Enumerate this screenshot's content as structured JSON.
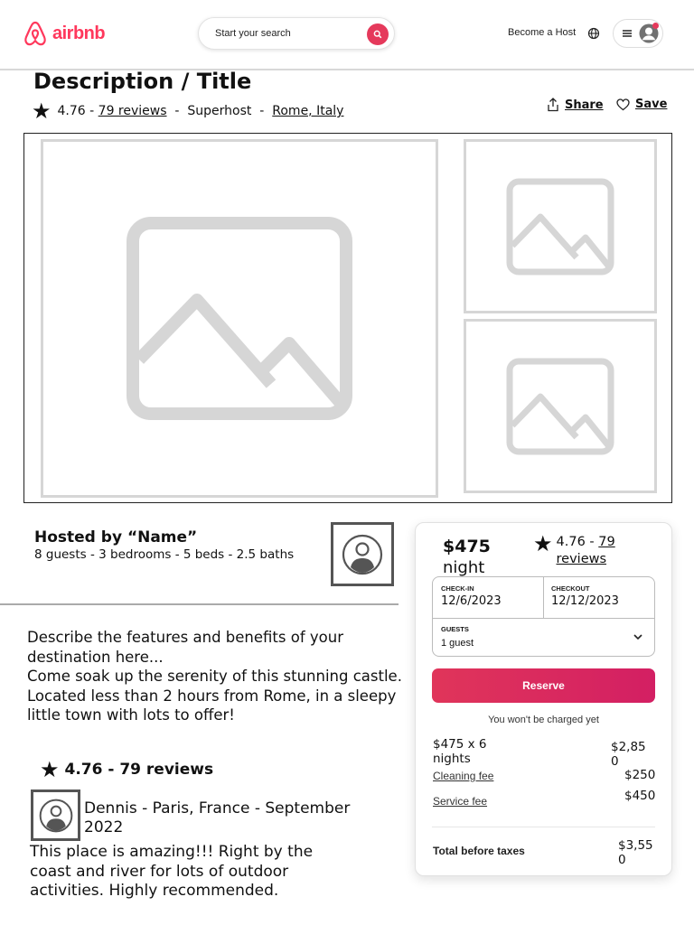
{
  "header": {
    "brand": "airbnb",
    "search_label": "Start your search",
    "host_link": "Become a Host",
    "colors": {
      "brand": "#ff385c",
      "accent": "#e5395b"
    }
  },
  "listing": {
    "title": "Description / Title",
    "rating": "4.76 -",
    "reviews_link": "79 reviews",
    "sep1": "-",
    "superhost": "Superhost",
    "sep2": "-",
    "location": "Rome, Italy",
    "share": "Share",
    "save": "Save"
  },
  "host": {
    "hosted_by": "Hosted by “Name”",
    "specs": "8 guests  -  3 bedrooms  -  5 beds  -  2.5 baths"
  },
  "description": {
    "lines": [
      "Describe the features and benefits of your destination here...",
      "Come soak up the serenity of this stunning castle.  Located less than 2 hours from Rome, in a sleepy little town with lots to offer!"
    ]
  },
  "reviews": {
    "heading": "4.76 - 79 reviews",
    "items": [
      {
        "author": "Dennis - Paris, France - September 2022",
        "text": "This place is amazing!!!  Right by the coast and river for lots of outdoor activities.  Highly recommended."
      }
    ]
  },
  "booking": {
    "price": "$475",
    "per": "night",
    "rating": "4.76 -",
    "reviews_link": "79 reviews",
    "checkin_label": "CHECK-IN",
    "checkin_value": "12/6/2023",
    "checkout_label": "CHECKOUT",
    "checkout_value": "12/12/2023",
    "guests_label": "GUESTS",
    "guests_value": "1 guest",
    "reserve": "Reserve",
    "notice": "You won't be charged yet",
    "nights_label": "$475 x 6 nights",
    "nights_value": "$2,850",
    "cleaning_label": "Cleaning fee",
    "cleaning_value": "$250",
    "service_label": "Service fee",
    "service_value": "$450",
    "total_label": "Total before taxes",
    "total_value": "$3,550"
  }
}
